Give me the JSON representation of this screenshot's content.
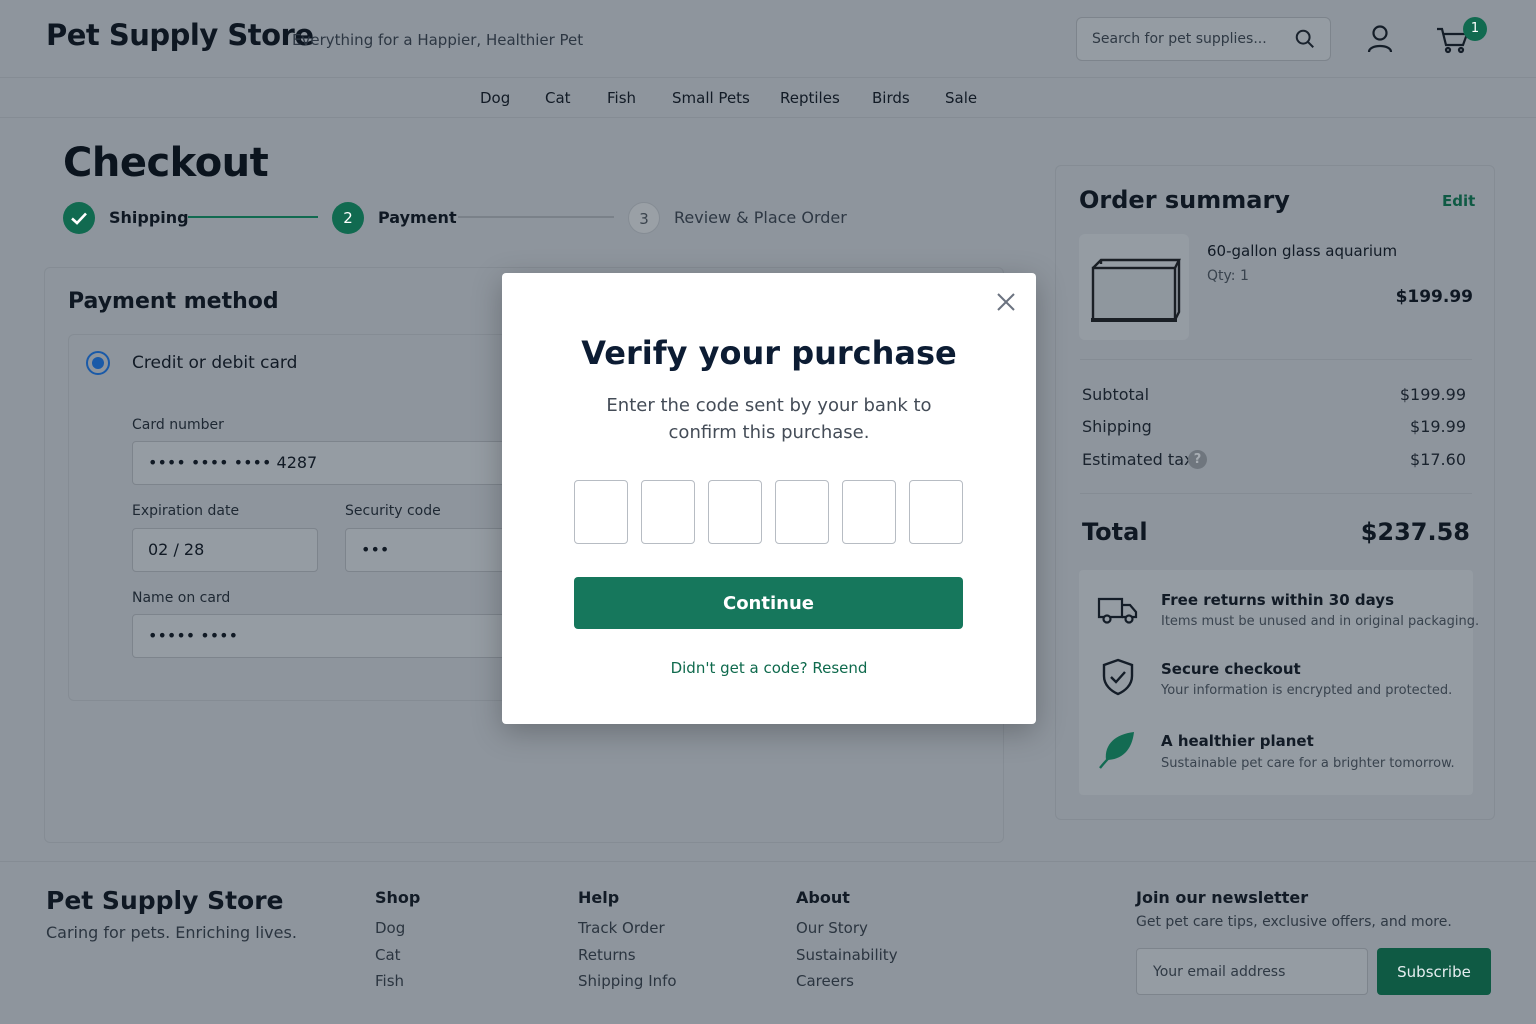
{
  "header": {
    "brand": "Pet Supply Store",
    "tagline": "Everything for a Happier, Healthier Pet",
    "search_placeholder": "Search for pet supplies...",
    "cart_count": "1"
  },
  "nav": {
    "items": [
      "Dog",
      "Cat",
      "Fish",
      "Small Pets",
      "Reptiles",
      "Birds",
      "Sale"
    ]
  },
  "checkout": {
    "title": "Checkout",
    "steps": [
      {
        "number": "1",
        "label": "Shipping",
        "state": "done"
      },
      {
        "number": "2",
        "label": "Payment",
        "state": "active"
      },
      {
        "number": "3",
        "label": "Review & Place Order",
        "state": "todo"
      }
    ]
  },
  "payment": {
    "title": "Payment method",
    "option_label": "Credit or debit card",
    "card_number_label": "Card number",
    "card_number_value": "•••• •••• •••• 4287",
    "expiry_label": "Expiration date",
    "expiry_value": "02 / 28",
    "security_label": "Security code",
    "security_value": "•••",
    "name_label": "Name on card",
    "name_value": "••••• ••••"
  },
  "summary": {
    "title": "Order summary",
    "edit_label": "Edit",
    "item": {
      "name": "60-gallon glass aquarium",
      "qty": "Qty: 1",
      "price": "$199.99"
    },
    "rows": [
      {
        "label": "Subtotal",
        "value": "$199.99"
      },
      {
        "label": "Shipping",
        "value": "$19.99"
      },
      {
        "label": "Estimated tax",
        "value": "$17.60"
      }
    ],
    "tax_help": "?",
    "total_label": "Total",
    "total_value": "$237.58",
    "perks": [
      {
        "icon": "truck-icon",
        "title": "Free returns within 30 days",
        "text": "Items must be unused and in original packaging."
      },
      {
        "icon": "shield-check-icon",
        "title": "Secure checkout",
        "text": "Your information is encrypted and protected."
      },
      {
        "icon": "leaf-icon",
        "title": "A healthier planet",
        "text": "Sustainable pet care for a brighter tomorrow."
      }
    ]
  },
  "footer": {
    "brand": "Pet Supply Store",
    "tagline": "Caring for pets. Enriching lives.",
    "columns": [
      {
        "heading": "Shop",
        "links": [
          "Dog",
          "Cat",
          "Fish"
        ]
      },
      {
        "heading": "Help",
        "links": [
          "Track Order",
          "Returns",
          "Shipping Info"
        ]
      },
      {
        "heading": "About",
        "links": [
          "Our Story",
          "Sustainability",
          "Careers"
        ]
      }
    ],
    "newsletter": {
      "heading": "Join our newsletter",
      "text": "Get pet care tips, exclusive offers, and more.",
      "placeholder": "Your email address",
      "button": "Subscribe"
    }
  },
  "modal": {
    "title": "Verify your purchase",
    "subtitle": "Enter the code sent by your bank to confirm this purchase.",
    "code_length": 6,
    "continue_label": "Continue",
    "resend_label": "Didn't get a code? Resend"
  },
  "colors": {
    "brand_green": "#16775c",
    "radio_blue": "#1a5aa8",
    "dim_background": "#8e959d"
  }
}
